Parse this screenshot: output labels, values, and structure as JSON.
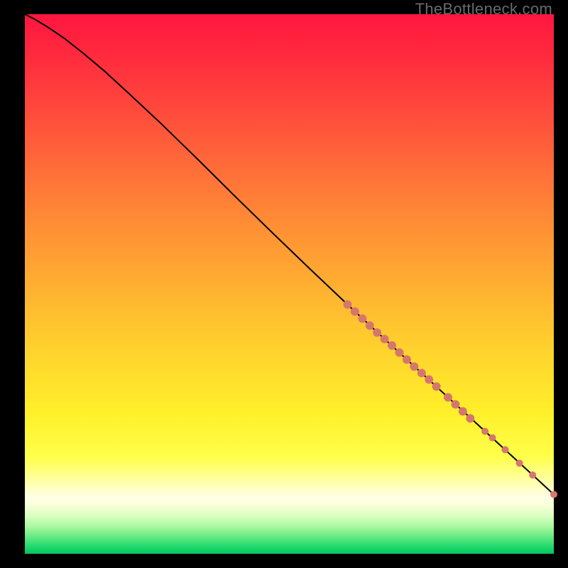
{
  "watermark": "TheBottleneck.com",
  "chart_data": {
    "type": "line",
    "title": "",
    "xlabel": "",
    "ylabel": "",
    "xlim": [
      0,
      1
    ],
    "ylim": [
      0,
      1
    ],
    "curve": [
      {
        "x": 0.0,
        "y": 1.0
      },
      {
        "x": 0.02,
        "y": 0.99
      },
      {
        "x": 0.045,
        "y": 0.975
      },
      {
        "x": 0.075,
        "y": 0.955
      },
      {
        "x": 0.11,
        "y": 0.928
      },
      {
        "x": 0.15,
        "y": 0.895
      },
      {
        "x": 0.2,
        "y": 0.85
      },
      {
        "x": 0.26,
        "y": 0.795
      },
      {
        "x": 0.33,
        "y": 0.728
      },
      {
        "x": 0.4,
        "y": 0.66
      },
      {
        "x": 0.47,
        "y": 0.593
      },
      {
        "x": 0.54,
        "y": 0.527
      },
      {
        "x": 0.61,
        "y": 0.462
      },
      {
        "x": 0.68,
        "y": 0.398
      },
      {
        "x": 0.75,
        "y": 0.335
      },
      {
        "x": 0.82,
        "y": 0.272
      },
      {
        "x": 0.89,
        "y": 0.209
      },
      {
        "x": 0.96,
        "y": 0.146
      },
      {
        "x": 1.0,
        "y": 0.11
      }
    ],
    "markers": [
      {
        "x": 0.61,
        "y": 0.462,
        "r": 6
      },
      {
        "x": 0.624,
        "y": 0.449,
        "r": 6
      },
      {
        "x": 0.638,
        "y": 0.436,
        "r": 6
      },
      {
        "x": 0.652,
        "y": 0.423,
        "r": 6
      },
      {
        "x": 0.666,
        "y": 0.41,
        "r": 6
      },
      {
        "x": 0.68,
        "y": 0.398,
        "r": 6
      },
      {
        "x": 0.694,
        "y": 0.386,
        "r": 6
      },
      {
        "x": 0.708,
        "y": 0.373,
        "r": 6
      },
      {
        "x": 0.722,
        "y": 0.36,
        "r": 6
      },
      {
        "x": 0.736,
        "y": 0.347,
        "r": 6
      },
      {
        "x": 0.75,
        "y": 0.335,
        "r": 6
      },
      {
        "x": 0.764,
        "y": 0.323,
        "r": 6
      },
      {
        "x": 0.778,
        "y": 0.31,
        "r": 6
      },
      {
        "x": 0.8,
        "y": 0.29,
        "r": 6
      },
      {
        "x": 0.814,
        "y": 0.277,
        "r": 6
      },
      {
        "x": 0.828,
        "y": 0.264,
        "r": 6
      },
      {
        "x": 0.842,
        "y": 0.251,
        "r": 6
      },
      {
        "x": 0.87,
        "y": 0.227,
        "r": 5
      },
      {
        "x": 0.884,
        "y": 0.215,
        "r": 5
      },
      {
        "x": 0.908,
        "y": 0.193,
        "r": 5
      },
      {
        "x": 0.935,
        "y": 0.168,
        "r": 5
      },
      {
        "x": 0.96,
        "y": 0.146,
        "r": 5
      },
      {
        "x": 1.0,
        "y": 0.11,
        "r": 5
      }
    ],
    "marker_color": "#d6776e",
    "curve_color": "#000000",
    "gradient_stops": [
      {
        "pos": 0.0,
        "color": "#ff163f"
      },
      {
        "pos": 0.5,
        "color": "#ffae31"
      },
      {
        "pos": 0.82,
        "color": "#ffff4a"
      },
      {
        "pos": 0.9,
        "color": "#ffffe8"
      },
      {
        "pos": 1.0,
        "color": "#0cc060"
      }
    ]
  }
}
